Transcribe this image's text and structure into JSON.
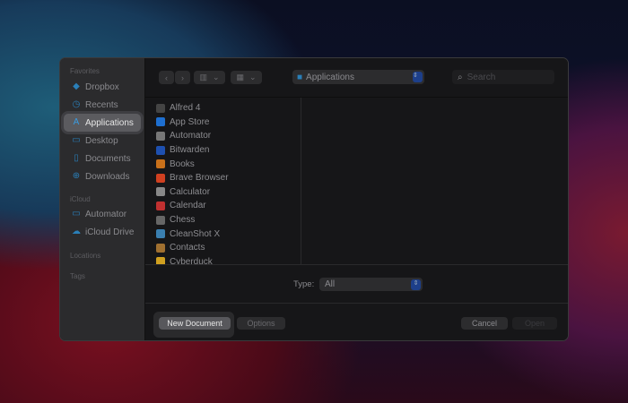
{
  "sidebar": {
    "favorites": "Favorites",
    "icloud": "iCloud",
    "locations": "Locations",
    "tags": "Tags",
    "fav_items": [
      {
        "label": "Dropbox",
        "icon": "dropbox-icon"
      },
      {
        "label": "Recents",
        "icon": "clock-icon"
      },
      {
        "label": "Applications",
        "icon": "applications-icon"
      },
      {
        "label": "Desktop",
        "icon": "desktop-icon"
      },
      {
        "label": "Documents",
        "icon": "document-icon"
      },
      {
        "label": "Downloads",
        "icon": "download-icon"
      }
    ],
    "icloud_items": [
      {
        "label": "Automator",
        "icon": "folder-icon"
      },
      {
        "label": "iCloud Drive",
        "icon": "cloud-icon"
      }
    ]
  },
  "toolbar": {
    "location": "Applications",
    "search_placeholder": "Search"
  },
  "files": [
    "Alfred 4",
    "App Store",
    "Automator",
    "Bitwarden",
    "Books",
    "Brave Browser",
    "Calculator",
    "Calendar",
    "Chess",
    "CleanShot X",
    "Contacts",
    "Cyberduck"
  ],
  "colors": {
    "accent": "#2a7fb8",
    "popup": "#1d3f8a"
  },
  "footer": {
    "type_label": "Type:",
    "type_value": "All",
    "new_document": "New Document",
    "options": "Options",
    "cancel": "Cancel",
    "open": "Open"
  }
}
